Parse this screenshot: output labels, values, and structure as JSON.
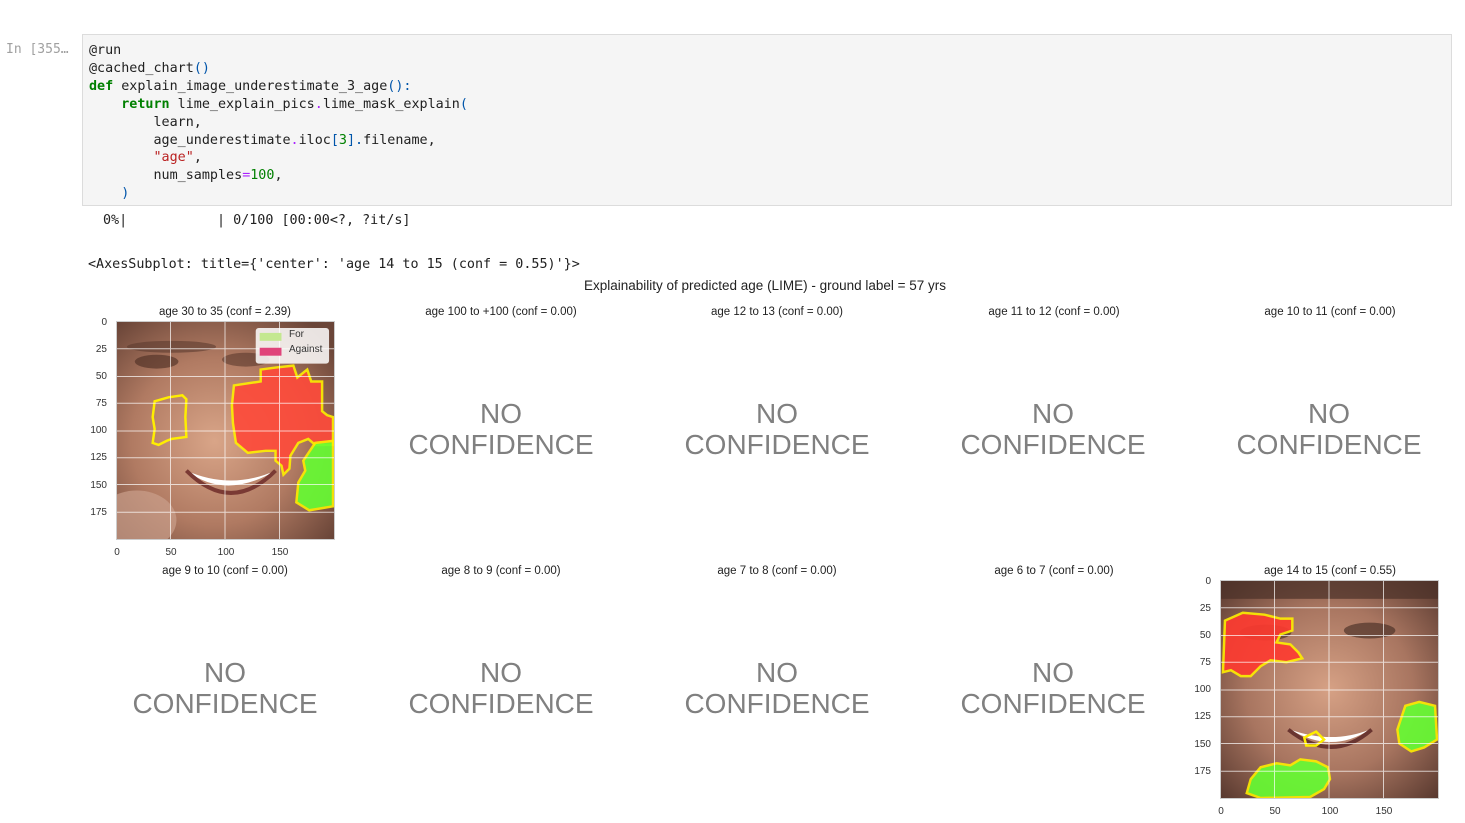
{
  "cell": {
    "prompt": "In [355…",
    "code_lines": [
      {
        "parts": [
          {
            "t": "@run",
            "c": ""
          }
        ]
      },
      {
        "parts": [
          {
            "t": "@cached_chart",
            "c": ""
          },
          {
            "t": "()",
            "c": "fn"
          }
        ]
      },
      {
        "parts": [
          {
            "t": "def",
            "c": "kw"
          },
          {
            "t": " explain_image_underestimate_3_age",
            "c": ""
          },
          {
            "t": "():",
            "c": "fn"
          }
        ]
      },
      {
        "parts": [
          {
            "t": "    ",
            "c": ""
          },
          {
            "t": "return",
            "c": "kw"
          },
          {
            "t": " lime_explain_pics",
            "c": ""
          },
          {
            "t": ".",
            "c": "op"
          },
          {
            "t": "lime_mask_explain",
            "c": ""
          },
          {
            "t": "(",
            "c": "fn"
          }
        ]
      },
      {
        "parts": [
          {
            "t": "        learn,",
            "c": ""
          }
        ]
      },
      {
        "parts": [
          {
            "t": "        age_underestimate",
            "c": ""
          },
          {
            "t": ".",
            "c": "op"
          },
          {
            "t": "iloc",
            "c": ""
          },
          {
            "t": "[",
            "c": "fn"
          },
          {
            "t": "3",
            "c": "num"
          },
          {
            "t": "].",
            "c": "fn"
          },
          {
            "t": "filename,",
            "c": ""
          }
        ]
      },
      {
        "parts": [
          {
            "t": "        ",
            "c": ""
          },
          {
            "t": "\"age\"",
            "c": "str"
          },
          {
            "t": ",",
            "c": ""
          }
        ]
      },
      {
        "parts": [
          {
            "t": "        num_samples",
            "c": ""
          },
          {
            "t": "=",
            "c": "op"
          },
          {
            "t": "100",
            "c": "num"
          },
          {
            "t": ",",
            "c": ""
          }
        ]
      },
      {
        "parts": [
          {
            "t": "    )",
            "c": "fn"
          }
        ]
      }
    ]
  },
  "output": {
    "progress_pct": "0%|",
    "progress_rest": "| 0/100 [00:00<?, ?it/s]",
    "axes_repr": "<AxesSubplot: title={'center': 'age 14 to 15 (conf = 0.55)'}>"
  },
  "figure": {
    "title": "Explainability of predicted age (LIME) - ground label = 57 yrs",
    "no_conf_line1": "NO",
    "no_conf_line2": "CONFIDENCE",
    "yticks": [
      "0",
      "25",
      "50",
      "75",
      "100",
      "125",
      "150",
      "175"
    ],
    "xticks": [
      "0",
      "50",
      "100",
      "150"
    ],
    "legend": {
      "for": "For",
      "against": "Against"
    },
    "colors": {
      "for": "#c4e890",
      "against": "#e0447a",
      "mask_outline": "#ffee00",
      "red_mask": "#ff4040",
      "green_mask": "#66ff33"
    },
    "subplots": [
      {
        "title": "age 30 to 35 (conf = 2.39)",
        "has_image": true
      },
      {
        "title": "age 100 to +100 (conf = 0.00)",
        "has_image": false
      },
      {
        "title": "age 12 to 13 (conf = 0.00)",
        "has_image": false
      },
      {
        "title": "age 11 to 12 (conf = 0.00)",
        "has_image": false
      },
      {
        "title": "age 10 to 11 (conf = 0.00)",
        "has_image": false
      },
      {
        "title": "age 9 to 10 (conf = 0.00)",
        "has_image": false
      },
      {
        "title": "age 8 to 9 (conf = 0.00)",
        "has_image": false
      },
      {
        "title": "age 7 to 8 (conf = 0.00)",
        "has_image": false
      },
      {
        "title": "age 6 to 7 (conf = 0.00)",
        "has_image": false
      },
      {
        "title": "age 14 to 15 (conf = 0.55)",
        "has_image": true
      }
    ]
  }
}
